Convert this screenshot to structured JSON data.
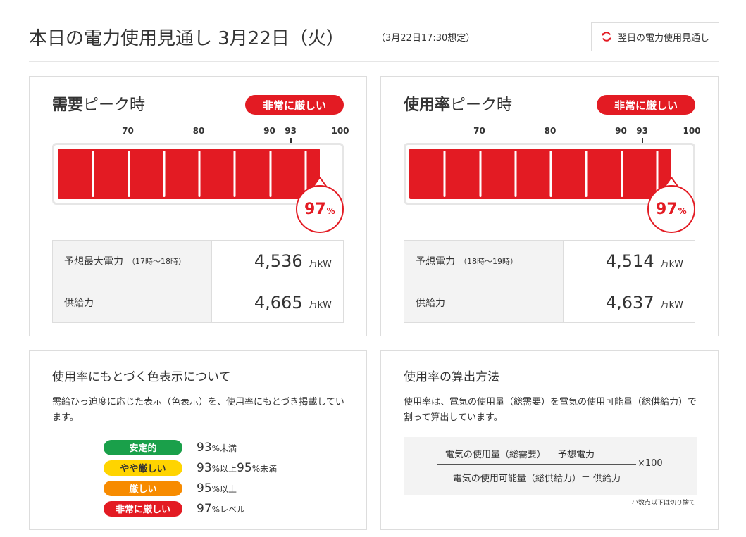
{
  "header": {
    "title": "本日の電力使用見通し 3月22日（火）",
    "subtitle": "（3月22日17:30想定）",
    "next_day_button": "翌日の電力使用見通し"
  },
  "demand_peak": {
    "title_bold": "需要",
    "title_rest": "ピーク時",
    "status": "非常に厳しい",
    "percent": "97",
    "percent_unit": "%",
    "usage_rate": 97,
    "rows": [
      {
        "label": "予想最大電力",
        "sub": "（17時〜18時）",
        "value": "4,536",
        "unit": "万kW"
      },
      {
        "label": "供給力",
        "sub": "",
        "value": "4,665",
        "unit": "万kW"
      }
    ]
  },
  "usage_peak": {
    "title_bold": "使用率",
    "title_rest": "ピーク時",
    "status": "非常に厳しい",
    "percent": "97",
    "percent_unit": "%",
    "usage_rate": 97,
    "rows": [
      {
        "label": "予想電力",
        "sub": "（18時〜19時）",
        "value": "4,514",
        "unit": "万kW"
      },
      {
        "label": "供給力",
        "sub": "",
        "value": "4,637",
        "unit": "万kW"
      }
    ]
  },
  "scale": {
    "ticks": [
      "70",
      "80",
      "90",
      "93",
      "100"
    ],
    "marked_tick": "93"
  },
  "colors": {
    "critical": "#e31b23",
    "stable": "#1aa04a",
    "somewhat_severe": "#ffd400",
    "severe": "#f78b00",
    "gauge_border": "#e6e6e6"
  },
  "color_legend": {
    "title": "使用率にもとづく色表示について",
    "description": "需給ひっ迫度に応じた表示（色表示）を、使用率にもとづき掲載しています。",
    "items": [
      {
        "label": "安定的",
        "color": "#1aa04a",
        "text_color": "#ffffff",
        "v1": "93",
        "s1": "%未満",
        "v2": "",
        "s2": ""
      },
      {
        "label": "やや厳しい",
        "color": "#ffd400",
        "text_color": "#333333",
        "v1": "93",
        "s1": "%以上",
        "v2": "95",
        "s2": "%未満"
      },
      {
        "label": "厳しい",
        "color": "#f78b00",
        "text_color": "#ffffff",
        "v1": "95",
        "s1": "%以上",
        "v2": "",
        "s2": ""
      },
      {
        "label": "非常に厳しい",
        "color": "#e31b23",
        "text_color": "#ffffff",
        "v1": "97",
        "s1": "%レベル",
        "v2": "",
        "s2": ""
      }
    ]
  },
  "calc_method": {
    "title": "使用率の算出方法",
    "description": "使用率は、電気の使用量（総需要）を電気の使用可能量（総供給力）で割って算出しています。",
    "numerator": "電気の使用量（総需要）＝ 予想電力",
    "denominator": "電気の使用可能量（総供給力）＝ 供給力",
    "multiplier": "×100",
    "note": "小数点以下は切り捨て"
  }
}
